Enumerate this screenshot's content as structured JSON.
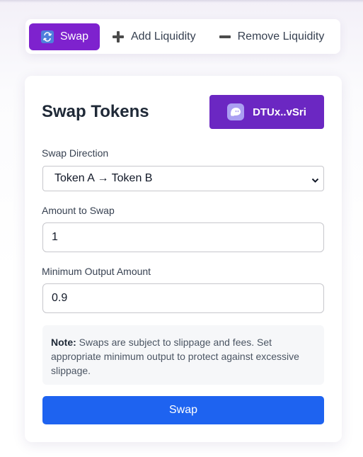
{
  "tabs": [
    {
      "label": "Swap",
      "icon": "swap-arrows-icon",
      "active": true
    },
    {
      "label": "Add Liquidity",
      "icon": "plus-icon",
      "active": false
    },
    {
      "label": "Remove Liquidity",
      "icon": "minus-icon",
      "active": false
    }
  ],
  "card": {
    "title": "Swap Tokens",
    "wallet": {
      "address": "DTUx..vSri",
      "icon": "phantom-ghost-icon"
    },
    "direction": {
      "label": "Swap Direction",
      "selected": "Token A → Token B"
    },
    "amount": {
      "label": "Amount to Swap",
      "value": "1"
    },
    "min_output": {
      "label": "Minimum Output Amount",
      "value": "0.9"
    },
    "note": {
      "prefix": "Note:",
      "text": "Swaps are subject to slippage and fees. Set appropriate minimum output to protect against excessive slippage."
    },
    "submit_label": "Swap"
  },
  "colors": {
    "active_tab": "#7e22ce",
    "wallet_button": "#6b27c2",
    "primary_button": "#1e63f0",
    "note_background": "#f6f7f9"
  }
}
